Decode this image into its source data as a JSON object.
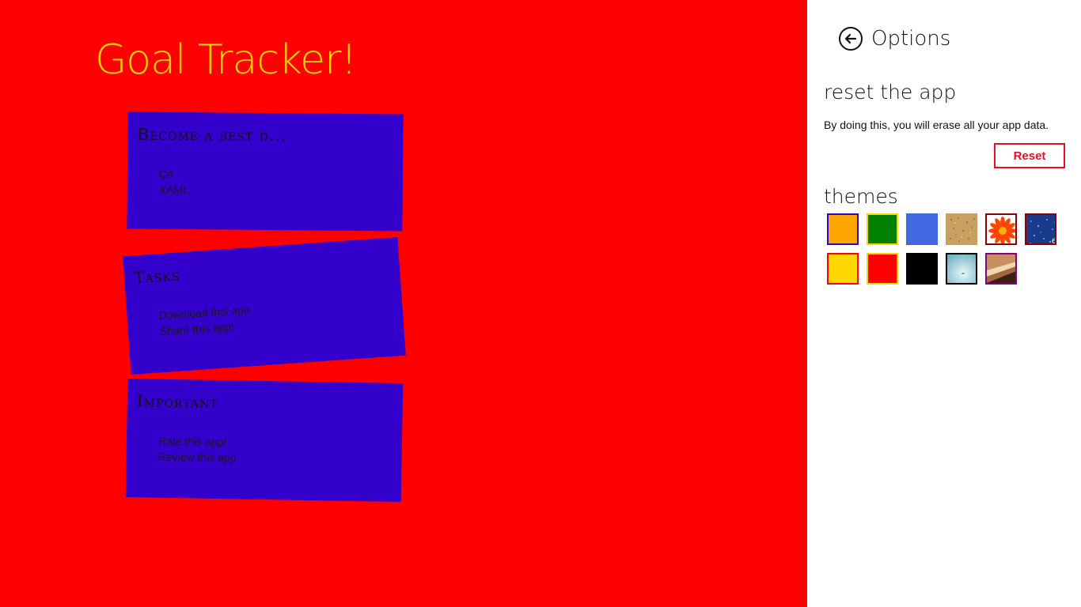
{
  "app": {
    "title": "Goal Tracker!"
  },
  "cards": [
    {
      "title": "Become a best d...",
      "items": [
        "C#",
        "XAML"
      ]
    },
    {
      "title": "Tasks",
      "items": [
        "Download this app",
        "Share this app!"
      ]
    },
    {
      "title": "Important",
      "items": [
        "Rate this app!",
        "Review this app"
      ]
    }
  ],
  "options": {
    "title": "Options",
    "back_icon": "back-arrow-icon",
    "reset_heading": "reset the app",
    "reset_description": "By doing this, you will erase all your app data.",
    "reset_button": "Reset",
    "themes_heading": "themes",
    "themes": [
      {
        "name": "orange",
        "color": "#ffa500",
        "border": "#3300cc"
      },
      {
        "name": "green",
        "color": "#008000",
        "border": "#ffd200"
      },
      {
        "name": "blue",
        "color": "#4169e1",
        "border": "#4169e1"
      },
      {
        "name": "sand",
        "color": "#c8a060",
        "border": "#c8a060"
      },
      {
        "name": "flower",
        "color": "#ffffff",
        "border": "#8b0000"
      },
      {
        "name": "blue-glitter",
        "color": "#1a3a8a",
        "border": "#8b0000"
      },
      {
        "name": "yellow",
        "color": "#ffd700",
        "border": "#ff0000"
      },
      {
        "name": "red",
        "color": "#ff0000",
        "border": "#ffd200"
      },
      {
        "name": "black",
        "color": "#000000",
        "border": "#000000"
      },
      {
        "name": "sky",
        "color": "#a8d8e0",
        "border": "#000000"
      },
      {
        "name": "books",
        "color": "#a07040",
        "border": "#800080"
      }
    ]
  }
}
